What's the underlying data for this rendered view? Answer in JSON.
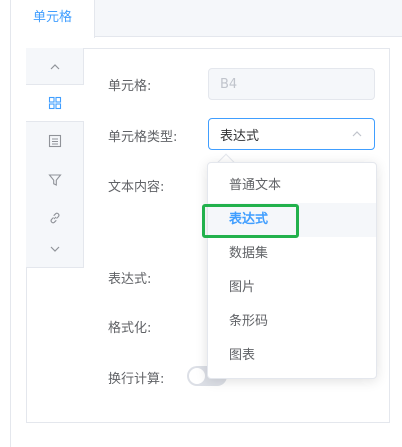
{
  "tabs": [
    {
      "label": "单元格"
    }
  ],
  "form": {
    "cell_label": "单元格:",
    "cell_value": "B4",
    "cell_type_label": "单元格类型:",
    "cell_type_value": "表达式",
    "content_label": "文本内容:",
    "expression_label": "表达式:",
    "format_label": "格式化:",
    "wrap_calc_label": "换行计算:",
    "wrap_calc_on": false
  },
  "side_nav": {
    "items": [
      {
        "icon": "chevron-up-icon"
      },
      {
        "icon": "grid-icon",
        "active": true
      },
      {
        "icon": "list-icon"
      },
      {
        "icon": "filter-icon"
      },
      {
        "icon": "link-icon"
      },
      {
        "icon": "chevron-down-icon"
      }
    ]
  },
  "dropdown": {
    "options": [
      {
        "label": "普通文本"
      },
      {
        "label": "表达式",
        "selected": true
      },
      {
        "label": "数据集"
      },
      {
        "label": "图片"
      },
      {
        "label": "条形码"
      },
      {
        "label": "图表"
      }
    ]
  },
  "colors": {
    "accent": "#409eff",
    "highlight": "#22b14c"
  }
}
